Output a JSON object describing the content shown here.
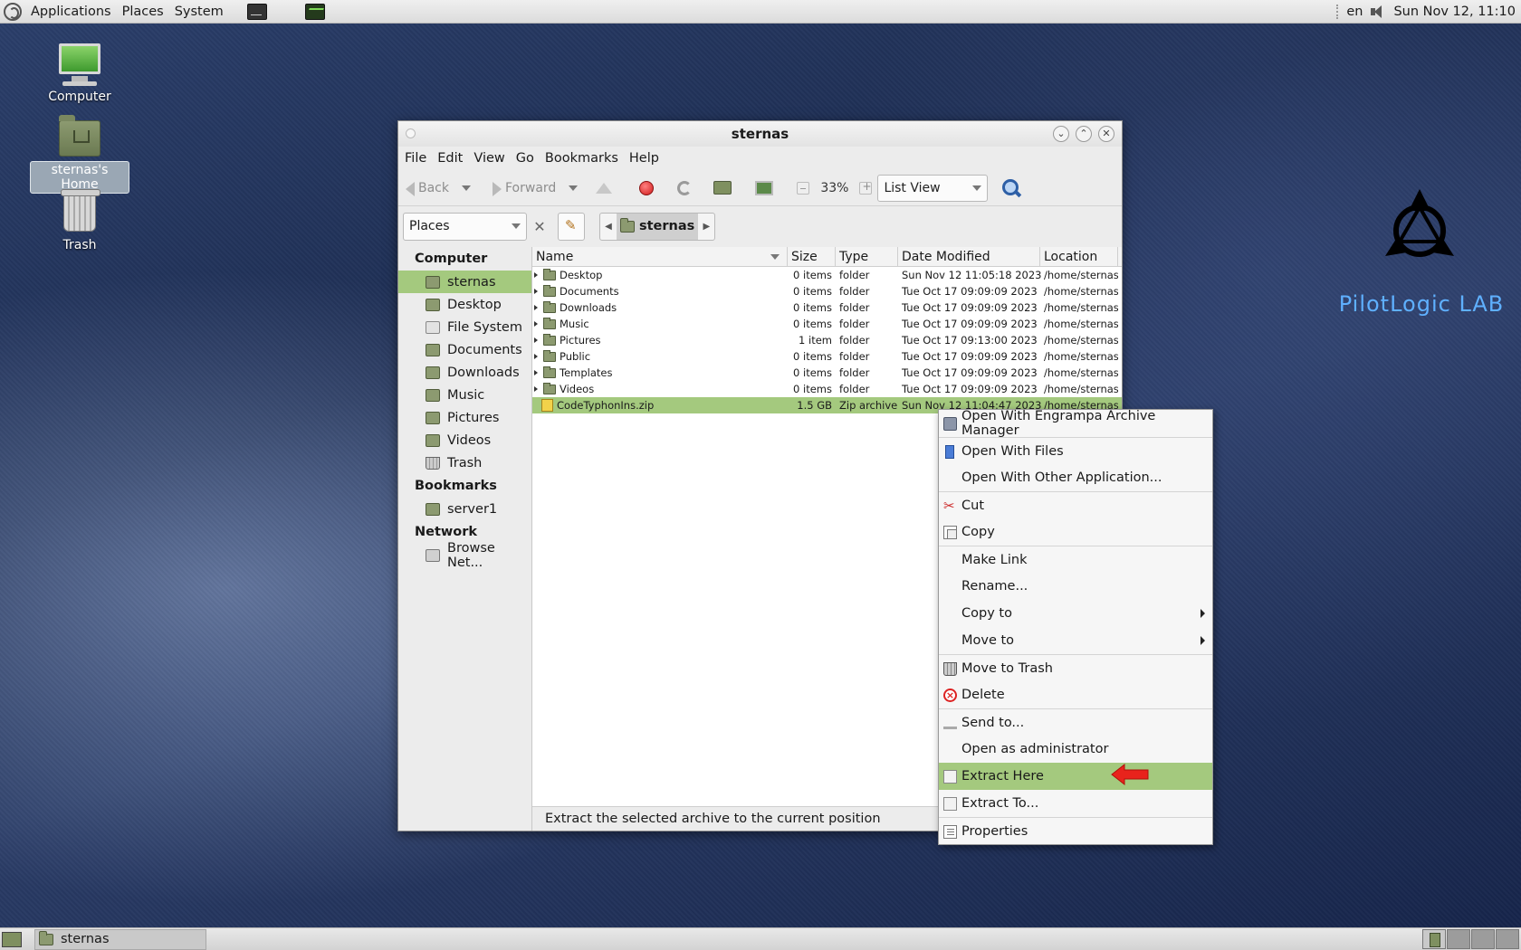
{
  "top_panel": {
    "menus": [
      "Applications",
      "Places",
      "System"
    ],
    "locale": "en",
    "clock": "Sun Nov 12, 11:10"
  },
  "desktop": {
    "icons": [
      {
        "label": "Computer"
      },
      {
        "label": "sternas's Home"
      },
      {
        "label": "Trash"
      }
    ],
    "brand": "PilotLogic LAB"
  },
  "window": {
    "title": "sternas",
    "menubar": [
      "File",
      "Edit",
      "View",
      "Go",
      "Bookmarks",
      "Help"
    ],
    "toolbar": {
      "back": "Back",
      "forward": "Forward",
      "zoom": "33%",
      "view_mode": "List View"
    },
    "location": {
      "places_label": "Places",
      "crumb": "sternas"
    },
    "sidebar": {
      "sections": [
        {
          "title": "Computer",
          "items": [
            "sternas",
            "Desktop",
            "File System",
            "Documents",
            "Downloads",
            "Music",
            "Pictures",
            "Videos",
            "Trash"
          ]
        },
        {
          "title": "Bookmarks",
          "items": [
            "server1"
          ]
        },
        {
          "title": "Network",
          "items": [
            "Browse Net..."
          ]
        }
      ],
      "selected": "sternas"
    },
    "columns": [
      "Name",
      "Size",
      "Type",
      "Date Modified",
      "Location"
    ],
    "files": [
      {
        "name": "Desktop",
        "size": "0 items",
        "type": "folder",
        "date": "Sun Nov 12 11:05:18 2023",
        "location": "/home/sternas"
      },
      {
        "name": "Documents",
        "size": "0 items",
        "type": "folder",
        "date": "Tue Oct 17 09:09:09 2023",
        "location": "/home/sternas"
      },
      {
        "name": "Downloads",
        "size": "0 items",
        "type": "folder",
        "date": "Tue Oct 17 09:09:09 2023",
        "location": "/home/sternas"
      },
      {
        "name": "Music",
        "size": "0 items",
        "type": "folder",
        "date": "Tue Oct 17 09:09:09 2023",
        "location": "/home/sternas"
      },
      {
        "name": "Pictures",
        "size": "1 item",
        "type": "folder",
        "date": "Tue Oct 17 09:13:00 2023",
        "location": "/home/sternas"
      },
      {
        "name": "Public",
        "size": "0 items",
        "type": "folder",
        "date": "Tue Oct 17 09:09:09 2023",
        "location": "/home/sternas"
      },
      {
        "name": "Templates",
        "size": "0 items",
        "type": "folder",
        "date": "Tue Oct 17 09:09:09 2023",
        "location": "/home/sternas"
      },
      {
        "name": "Videos",
        "size": "0 items",
        "type": "folder",
        "date": "Tue Oct 17 09:09:09 2023",
        "location": "/home/sternas"
      },
      {
        "name": "CodeTyphonIns.zip",
        "size": "1.5 GB",
        "type": "Zip archive",
        "date": "Sun Nov 12 11:04:47 2023",
        "location": "/home/sternas"
      }
    ],
    "status": "Extract the selected archive to the current position"
  },
  "context_menu": {
    "items": [
      {
        "label": "Open With Engrampa Archive Manager",
        "icon": "archive-icon"
      },
      {
        "label": "Open With Files",
        "icon": "files-icon"
      },
      {
        "label": "Open With Other Application...",
        "icon": ""
      },
      {
        "label": "Cut",
        "icon": "scissors-icon"
      },
      {
        "label": "Copy",
        "icon": "copy-icon"
      },
      {
        "label": "Make Link",
        "icon": ""
      },
      {
        "label": "Rename...",
        "icon": ""
      },
      {
        "label": "Copy to",
        "icon": "",
        "submenu": true
      },
      {
        "label": "Move to",
        "icon": "",
        "submenu": true
      },
      {
        "label": "Move to Trash",
        "icon": "trash-icon"
      },
      {
        "label": "Delete",
        "icon": "delete-icon"
      },
      {
        "label": "Send to...",
        "icon": "send-icon"
      },
      {
        "label": "Open as administrator",
        "icon": ""
      },
      {
        "label": "Extract Here",
        "icon": "extract-icon",
        "highlighted": true
      },
      {
        "label": "Extract To...",
        "icon": "extract-icon"
      },
      {
        "label": "Properties",
        "icon": "properties-icon"
      }
    ]
  },
  "bottom_panel": {
    "task": "sternas"
  },
  "colors": {
    "selection": "#a4c97e",
    "brand": "#5fb0ff",
    "annotation_arrow": "#e8231c"
  }
}
